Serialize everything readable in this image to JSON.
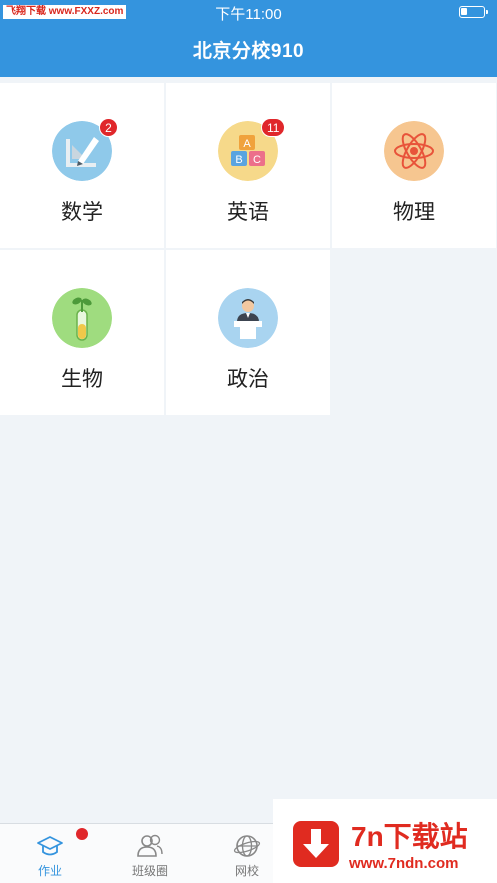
{
  "status_bar": {
    "watermark": "飞翔下载 www.FXXZ.com",
    "time": "下午11:00"
  },
  "header": {
    "title": "北京分校910"
  },
  "subjects": [
    {
      "label": "数学",
      "badge": "2",
      "icon": "geometry-tools-icon"
    },
    {
      "label": "英语",
      "badge": "11",
      "icon": "abc-blocks-icon"
    },
    {
      "label": "物理",
      "badge": "",
      "icon": "atom-icon"
    },
    {
      "label": "生物",
      "badge": "",
      "icon": "test-tube-plant-icon"
    },
    {
      "label": "政治",
      "badge": "",
      "icon": "speaker-podium-icon"
    }
  ],
  "tabbar": {
    "tabs": [
      {
        "label": "作业",
        "icon": "graduation-cap-icon",
        "active": true
      },
      {
        "label": "班级圈",
        "icon": "people-icon",
        "active": false
      },
      {
        "label": "网校",
        "icon": "globe-icon",
        "active": false
      }
    ]
  },
  "watermark_br": {
    "title": "7n下载站",
    "url": "www.7ndn.com"
  },
  "colors": {
    "primary": "#3494de",
    "badge_red": "#e0272b",
    "background": "#f0f4f8"
  }
}
